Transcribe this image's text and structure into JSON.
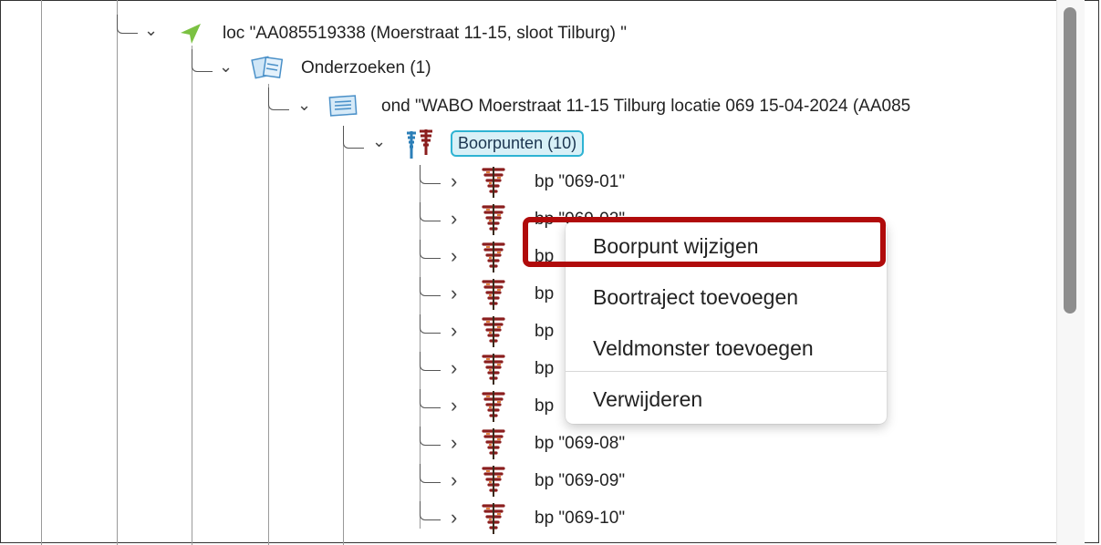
{
  "tree": {
    "loc": {
      "label": "loc \"AA085519338 (Moerstraat 11-15, sloot Tilburg) \""
    },
    "onderzoeken": {
      "label": "Onderzoeken (1)"
    },
    "ond": {
      "label": "ond \"WABO Moerstraat 11-15 Tilburg locatie 069 15-04-2024 (AA085"
    },
    "boorpunten": {
      "label": "Boorpunten (10)"
    },
    "bp": [
      {
        "label": "bp \"069-01\""
      },
      {
        "label": "bp \"069-02\""
      },
      {
        "label": "bp"
      },
      {
        "label": "bp"
      },
      {
        "label": "bp"
      },
      {
        "label": "bp"
      },
      {
        "label": "bp"
      },
      {
        "label": "bp \"069-08\""
      },
      {
        "label": "bp \"069-09\""
      },
      {
        "label": "bp \"069-10\""
      }
    ]
  },
  "context_menu": {
    "items": [
      {
        "label": "Boorpunt wijzigen"
      },
      {
        "label": "Boortraject toevoegen"
      },
      {
        "label": "Veldmonster toevoegen"
      },
      {
        "label": "Verwijderen"
      }
    ]
  },
  "colors": {
    "highlight": "#b00b0b",
    "selection_border": "#2eb3d3",
    "selection_fill": "#d8f0f7",
    "loc_icon": "#7bc142"
  }
}
